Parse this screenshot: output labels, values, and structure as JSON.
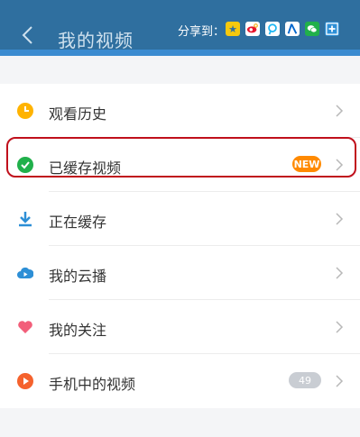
{
  "header": {
    "title": "我的视频",
    "share_label": "分享到："
  },
  "share_targets": [
    {
      "name": "qzone",
      "color": "#f6c90e"
    },
    {
      "name": "weibo",
      "color": "#e6162d"
    },
    {
      "name": "tencent-weibo",
      "color": "#1eb7f3"
    },
    {
      "name": "renren",
      "color": "#0066cc"
    },
    {
      "name": "wechat",
      "color": "#21b04b"
    },
    {
      "name": "more",
      "color": "#2d8fd6"
    }
  ],
  "menu": [
    {
      "label": "观看历史",
      "icon": "clock-icon",
      "color": "#ffb300"
    },
    {
      "label": "已缓存视频",
      "icon": "check-icon",
      "color": "#21b04b",
      "badge": "NEW"
    },
    {
      "label": "正在缓存",
      "icon": "download-icon",
      "color": "#2d8fd6"
    },
    {
      "label": "我的云播",
      "icon": "cloud-play-icon",
      "color": "#2d8fd6"
    },
    {
      "label": "我的关注",
      "icon": "heart-icon",
      "color": "#f25f7a"
    },
    {
      "label": "手机中的视频",
      "icon": "play-icon",
      "color": "#f5622d",
      "count": "49"
    }
  ]
}
